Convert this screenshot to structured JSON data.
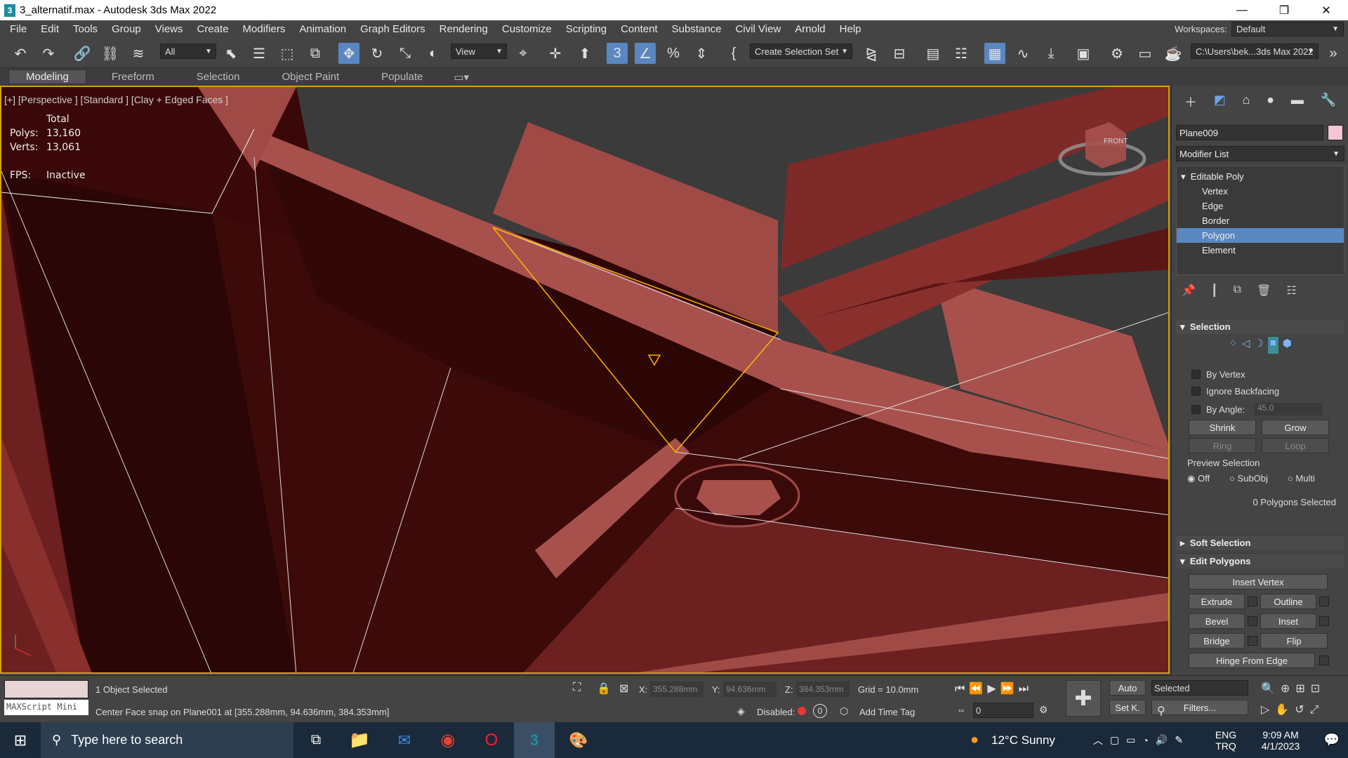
{
  "window": {
    "title": "3_alternatif.max - Autodesk 3ds Max 2022",
    "minimize": "—",
    "restore": "❐",
    "close": "✕"
  },
  "menu": [
    "File",
    "Edit",
    "Tools",
    "Group",
    "Views",
    "Create",
    "Modifiers",
    "Animation",
    "Graph Editors",
    "Rendering",
    "Customize",
    "Scripting",
    "Content",
    "Substance",
    "Civil View",
    "Arnold",
    "Help"
  ],
  "workspaces": {
    "label": "Workspaces:",
    "value": "Default"
  },
  "toolbar": {
    "filter": "All",
    "ref_coord": "View",
    "selection_set": "Create Selection Set",
    "path": "C:\\Users\\bek...3ds Max 2022"
  },
  "ribbon_tabs": [
    "Modeling",
    "Freeform",
    "Selection",
    "Object Paint",
    "Populate"
  ],
  "viewport": {
    "label": "[+] [Perspective ] [Standard ] [Clay + Edged Faces ]",
    "stats_total": "Total",
    "polys_label": "Polys:",
    "polys_value": "13,160",
    "verts_label": "Verts:",
    "verts_value": "13,061",
    "fps_label": "FPS:",
    "fps_value": "Inactive",
    "viewcube_label": "FRONT"
  },
  "command_panel": {
    "object_name": "Plane009",
    "object_color": "#f4c6d6",
    "modifier_list": "Modifier List",
    "stack": [
      "Editable Poly",
      "Vertex",
      "Edge",
      "Border",
      "Polygon",
      "Element"
    ],
    "stack_selected": "Polygon",
    "selection": {
      "title": "Selection",
      "by_vertex": "By Vertex",
      "ignore_backfacing": "Ignore Backfacing",
      "by_angle": "By Angle:",
      "angle_value": "45.0",
      "shrink": "Shrink",
      "grow": "Grow",
      "ring": "Ring",
      "loop": "Loop",
      "preview_title": "Preview Selection",
      "preview_options": [
        "Off",
        "SubObj",
        "Multi"
      ],
      "preview_selected": "Off",
      "count_text": "0 Polygons Selected"
    },
    "soft_selection": "Soft Selection",
    "edit_polygons": {
      "title": "Edit Polygons",
      "insert_vertex": "Insert Vertex",
      "extrude": "Extrude",
      "outline": "Outline",
      "bevel": "Bevel",
      "inset": "Inset",
      "bridge": "Bridge",
      "flip": "Flip",
      "hinge": "Hinge From Edge"
    }
  },
  "status": {
    "maxscript": "MAXScript Mini",
    "selected": "1 Object Selected",
    "prompt": "Center Face snap on Plane001 at [355.288mm, 94.636mm, 384.353mm]",
    "x_label": "X:",
    "x_value": "355.288mm",
    "y_label": "Y:",
    "y_value": "94.636mm",
    "z_label": "Z:",
    "z_value": "384.353mm",
    "grid": "Grid = 10.0mm",
    "disabled_label": "Disabled:",
    "add_time_tag": "Add Time Tag",
    "auto": "Auto",
    "setk": "Set K.",
    "key_mode": "Selected",
    "filters": "Filters...",
    "frame": "0"
  },
  "taskbar": {
    "search_placeholder": "Type here to search",
    "weather_temp": "12°C",
    "weather_text": "Sunny",
    "lang1": "ENG",
    "lang2": "TRQ",
    "time": "9:09 AM",
    "date": "4/1/2023"
  },
  "colors": {
    "accent": "#5b87c1",
    "viewport_border": "#d4a300",
    "selected_edge": "#ffb400",
    "model_dark": "#3d0a0a",
    "model_light": "#a04a45"
  }
}
